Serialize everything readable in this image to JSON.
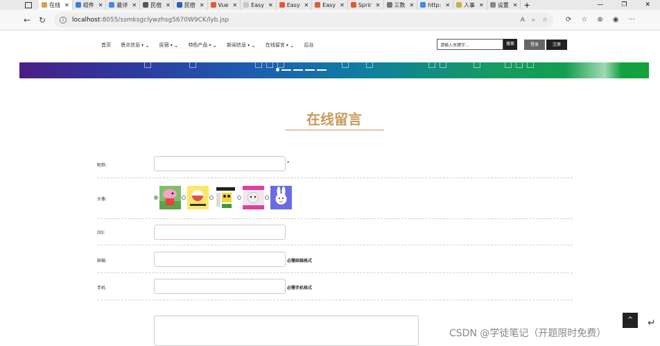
{
  "browser": {
    "tabs": [
      {
        "label": "在线",
        "color": "#d8a050",
        "active": true
      },
      {
        "label": "组件",
        "color": "#3b7de0"
      },
      {
        "label": "最详",
        "color": "#3f8ce8"
      },
      {
        "label": "民宿",
        "color": "#555"
      },
      {
        "label": "民宿",
        "color": "#2b5fb8"
      },
      {
        "label": "Vue",
        "color": "#e05a3a"
      },
      {
        "label": "Easy",
        "color": "#c8c8c8"
      },
      {
        "label": "Easy",
        "color": "#e05a3a"
      },
      {
        "label": "Easy",
        "color": "#e05a3a"
      },
      {
        "label": "Sprir",
        "color": "#e05a3a"
      },
      {
        "label": "三数",
        "color": "#777"
      },
      {
        "label": "http:",
        "color": "#4285f4"
      },
      {
        "label": "人事",
        "color": "#c9b048"
      },
      {
        "label": "设置",
        "color": "#888"
      }
    ],
    "url_host": "localhost",
    "url_path": ":8055/ssmksgclywzhsg5670W9CK/lyb.jsp"
  },
  "nav": {
    "items": [
      {
        "label": "首页",
        "caret": false,
        "chev": false
      },
      {
        "label": "景点信息",
        "caret": true,
        "chev": true
      },
      {
        "label": "民宿",
        "caret": true,
        "chev": true
      },
      {
        "label": "特色产品",
        "caret": true,
        "chev": true
      },
      {
        "label": "新闻信息",
        "caret": true,
        "chev": true
      },
      {
        "label": "在线留言",
        "caret": true,
        "chev": true
      },
      {
        "label": "后台",
        "caret": false,
        "chev": false
      }
    ],
    "search_placeholder": "请输入关键字...",
    "search_button": "搜索",
    "login_button": "登录",
    "register_button": "注册"
  },
  "page": {
    "title": "在线留言"
  },
  "form": {
    "nickname_label": "昵称:",
    "required_mark": "*",
    "avatar_label": "头像:",
    "qq_label": "QQ:",
    "email_label": "邮箱:",
    "email_hint": "必需邮箱格式",
    "phone_label": "手机:",
    "phone_hint": "必需手机格式",
    "avatars": [
      {
        "name": "peppa-pig",
        "checked": true
      },
      {
        "name": "yellow-cartoon",
        "checked": false
      },
      {
        "name": "spongebob-meme",
        "checked": false
      },
      {
        "name": "bear-meme",
        "checked": false
      },
      {
        "name": "bunny",
        "checked": false
      }
    ]
  },
  "overlay": {
    "back_to_top": "^",
    "watermark": "CSDN @学徒笔记（开题限时免费）",
    "enter_glyph": "↵"
  },
  "colors": {
    "accent": "#c99a5a"
  }
}
